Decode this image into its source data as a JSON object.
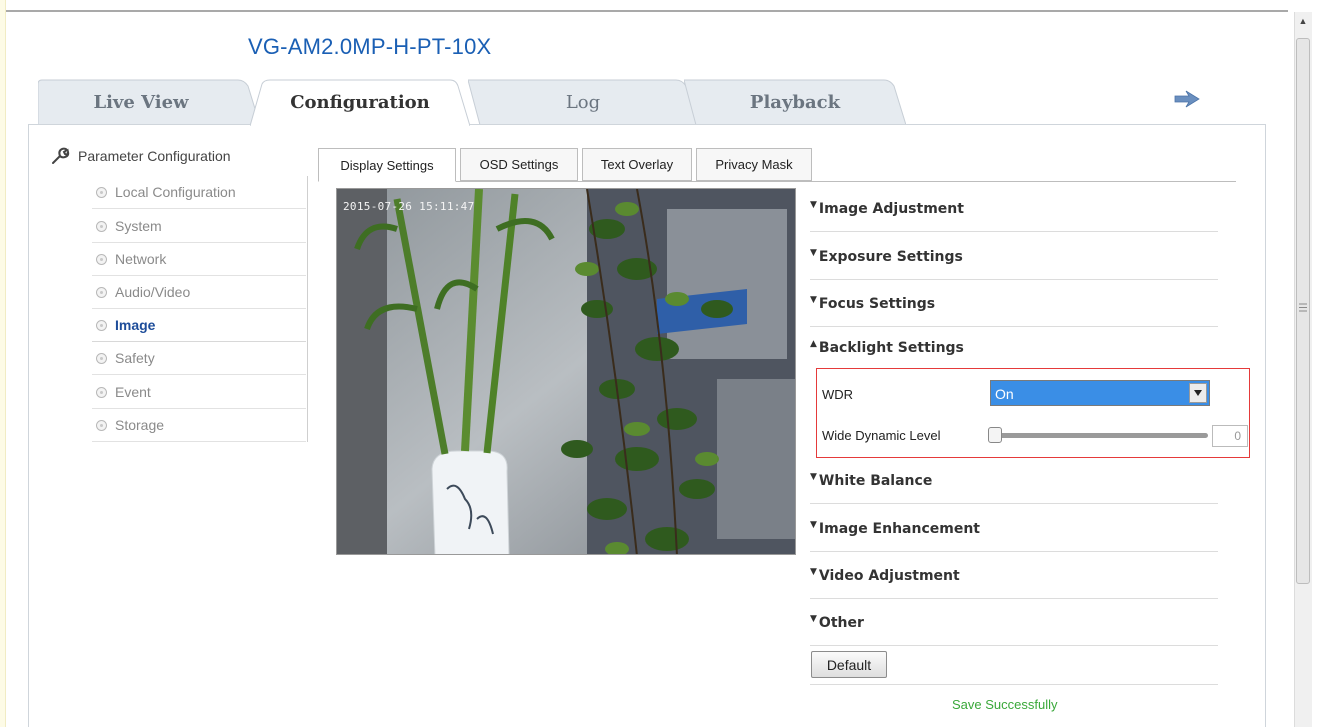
{
  "app": {
    "title": "VG-AM2.0MP-H-PT-10X"
  },
  "main_tabs": [
    {
      "label": "Live View"
    },
    {
      "label": "Configuration"
    },
    {
      "label": "Log"
    },
    {
      "label": "Playback"
    }
  ],
  "sidebar": {
    "header": "Parameter Configuration",
    "items": [
      {
        "label": "Local Configuration"
      },
      {
        "label": "System"
      },
      {
        "label": "Network"
      },
      {
        "label": "Audio/Video"
      },
      {
        "label": "Image"
      },
      {
        "label": "Safety"
      },
      {
        "label": "Event"
      },
      {
        "label": "Storage"
      }
    ],
    "active": "Image"
  },
  "sub_tabs": [
    {
      "label": "Display Settings"
    },
    {
      "label": "OSD Settings"
    },
    {
      "label": "Text Overlay"
    },
    {
      "label": "Privacy Mask"
    }
  ],
  "video": {
    "timestamp": "2015-07-26 15:11:47"
  },
  "sections": [
    {
      "label": "Image Adjustment",
      "expanded": false
    },
    {
      "label": "Exposure Settings",
      "expanded": false
    },
    {
      "label": "Focus Settings",
      "expanded": false
    },
    {
      "label": "Backlight Settings",
      "expanded": true
    },
    {
      "label": "White Balance",
      "expanded": false
    },
    {
      "label": "Image Enhancement",
      "expanded": false
    },
    {
      "label": "Video Adjustment",
      "expanded": false
    },
    {
      "label": "Other",
      "expanded": false
    }
  ],
  "backlight": {
    "wdr_label": "WDR",
    "wdr_value": "On",
    "wide_dynamic_label": "Wide Dynamic Level",
    "wide_dynamic_value": "0"
  },
  "buttons": {
    "default": "Default"
  },
  "status": {
    "message": "Save Successfully"
  },
  "colors": {
    "title": "#1a5fb4",
    "highlight": "#e53a3a",
    "success": "#3aa83a",
    "select": "#3a8ee6"
  },
  "icons": [
    "wrench-icon",
    "arrow-right-icon",
    "dropdown-arrow-icon",
    "scroll-up-icon"
  ]
}
